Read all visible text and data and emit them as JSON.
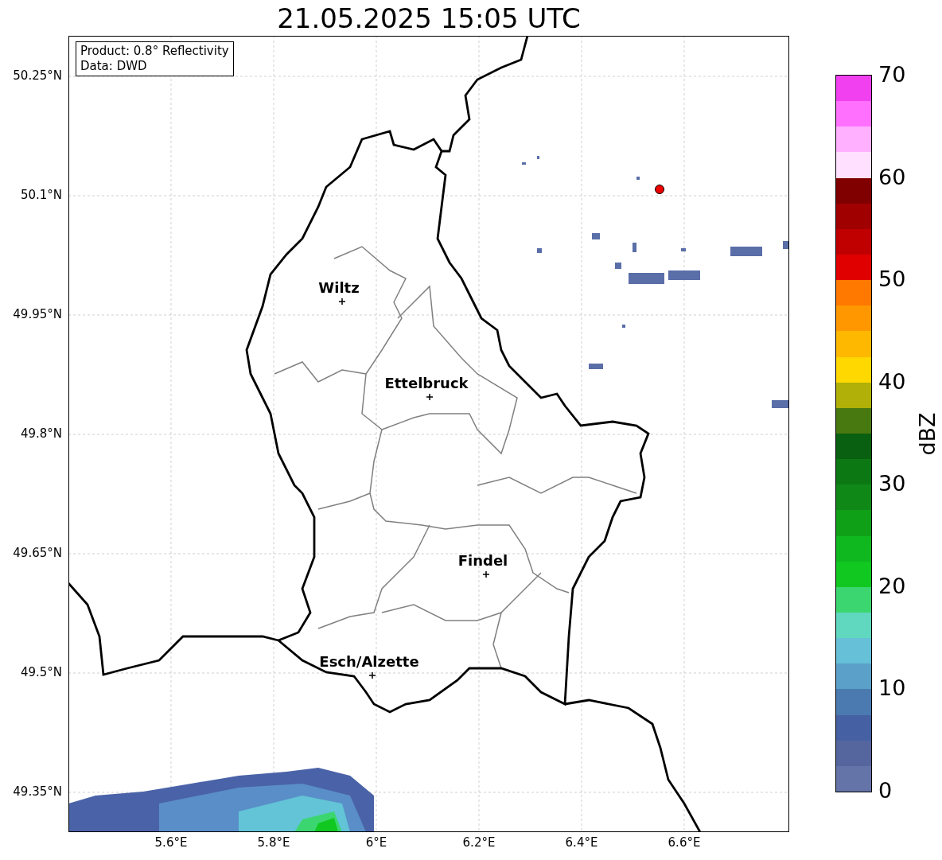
{
  "title": "21.05.2025 15:05 UTC",
  "info_box": [
    "Product: 0.8° Reflectivity",
    "Data: DWD"
  ],
  "y_ticks": [
    "50.25°N",
    "50.1°N",
    "49.95°N",
    "49.8°N",
    "49.65°N",
    "49.5°N",
    "49.35°N"
  ],
  "x_ticks": [
    "5.6°E",
    "5.8°E",
    "6°E",
    "6.2°E",
    "6.4°E",
    "6.6°E"
  ],
  "cities": [
    {
      "name": "Wiltz"
    },
    {
      "name": "Ettelbruck"
    },
    {
      "name": "Findel"
    },
    {
      "name": "Esch/Alzette"
    }
  ],
  "colorbar": {
    "label": "dBZ",
    "ticks": [
      "70",
      "60",
      "50",
      "40",
      "30",
      "20",
      "10",
      "0"
    ],
    "segments": [
      {
        "color": "#f040f0"
      },
      {
        "color": "#ff70ff"
      },
      {
        "color": "#ffb0ff"
      },
      {
        "color": "#ffe0ff"
      },
      {
        "color": "#800000"
      },
      {
        "color": "#a00000"
      },
      {
        "color": "#c00000"
      },
      {
        "color": "#e00000"
      },
      {
        "color": "#ff7800"
      },
      {
        "color": "#ff9800"
      },
      {
        "color": "#ffb800"
      },
      {
        "color": "#ffd800"
      },
      {
        "color": "#b0b008"
      },
      {
        "color": "#487810"
      },
      {
        "color": "#086010"
      },
      {
        "color": "#0c7814"
      },
      {
        "color": "#108818"
      },
      {
        "color": "#10a018"
      },
      {
        "color": "#10b820"
      },
      {
        "color": "#10c820"
      },
      {
        "color": "#3cd670"
      },
      {
        "color": "#60d8c0"
      },
      {
        "color": "#65c0d8"
      },
      {
        "color": "#5aa0c8"
      },
      {
        "color": "#4a7ab0"
      },
      {
        "color": "#4660a4"
      },
      {
        "color": "#55669e"
      },
      {
        "color": "#6474a8"
      }
    ]
  }
}
